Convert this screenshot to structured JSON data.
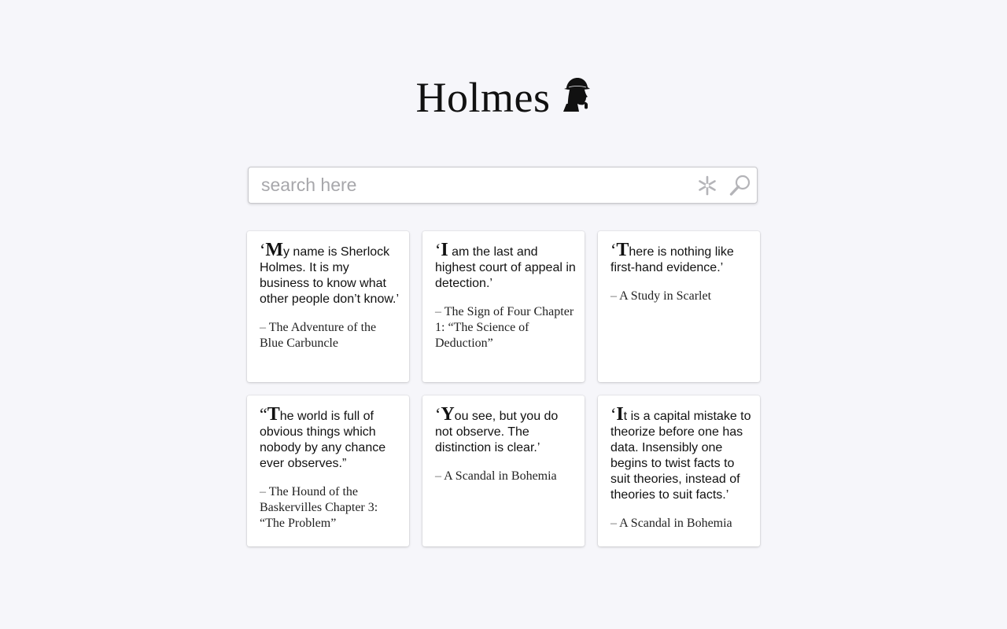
{
  "app": {
    "title": "Holmes",
    "logo_icon": "sherlock-silhouette-icon"
  },
  "search": {
    "placeholder": "search here",
    "value": "",
    "regex_icon": "asterisk-icon",
    "submit_icon": "magnifier-icon"
  },
  "cards": [
    {
      "open_quote": "‘",
      "first_letter": "M",
      "text": "y name is Sherlock Holmes. It is my business to know what other people don’t know.’",
      "dash": "–",
      "source": "The Adventure of the Blue Carbuncle"
    },
    {
      "open_quote": "‘",
      "first_letter": "I",
      "text": " am the last and highest court of appeal in detection.’",
      "dash": "–",
      "source": "The Sign of Four Chapter 1: “The Science of Deduction”"
    },
    {
      "open_quote": "‘",
      "first_letter": "T",
      "text": "here is nothing like first-hand evidence.’",
      "dash": "–",
      "source": "A Study in Scarlet"
    },
    {
      "open_quote": "“",
      "first_letter": "T",
      "text": "he world is full of obvious things which nobody by any chance ever observes.”",
      "dash": "–",
      "source": "The Hound of the Baskervilles Chapter 3: “The Problem”"
    },
    {
      "open_quote": "‘",
      "first_letter": "Y",
      "text": "ou see, but you do not observe. The distinction is clear.’",
      "dash": "–",
      "source": "A Scandal in Bohemia"
    },
    {
      "open_quote": "‘",
      "first_letter": "I",
      "text": "t is a capital mistake to theorize before one has data. Insensibly one begins to twist facts to suit theories, instead of theories to suit facts.’",
      "dash": "–",
      "source": "A Scandal in Bohemia"
    }
  ],
  "colors": {
    "background": "#f6f6fa",
    "card": "#ffffff",
    "text": "#111111",
    "placeholder": "#a7a7ab",
    "icon": "#b4b4b8"
  }
}
